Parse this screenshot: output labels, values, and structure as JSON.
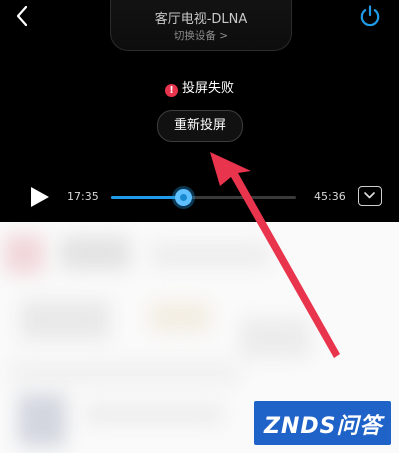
{
  "header": {
    "device_name": "客厅电视-DLNA",
    "switch_device_label": "切换设备 >"
  },
  "cast": {
    "status_text": "投屏失败",
    "retry_label": "重新投屏"
  },
  "playback": {
    "current_time": "17:35",
    "total_time": "45:36",
    "progress": 0.39
  },
  "colors": {
    "accent": "#1f9be8",
    "error": "#e8344c",
    "annotation_arrow": "#e8344c",
    "watermark_bg": "#1f62c8"
  },
  "icons": {
    "back": "chevron-left-icon",
    "power": "power-icon",
    "play": "play-icon",
    "collapse": "chevron-down-icon",
    "error": "exclamation-icon"
  },
  "watermark": {
    "text": "ZNDS问答"
  }
}
